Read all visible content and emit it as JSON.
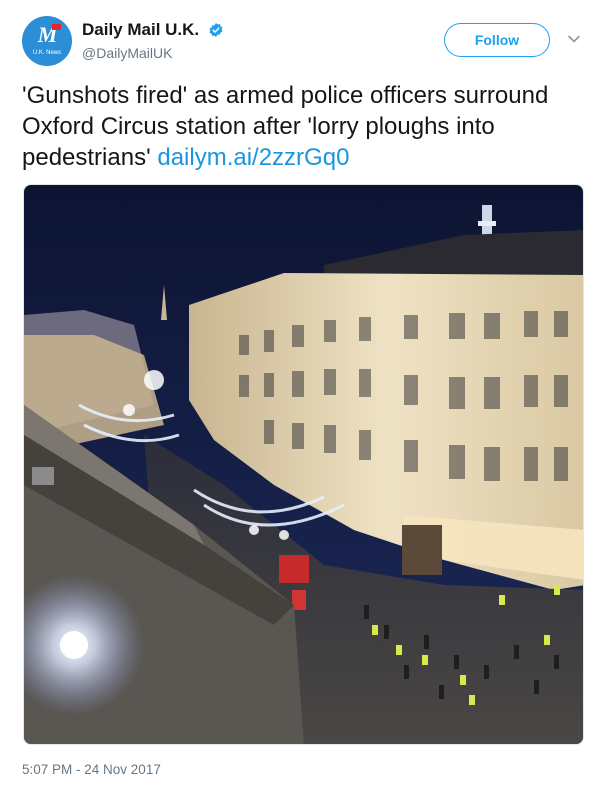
{
  "account": {
    "display_name": "Daily Mail U.K.",
    "handle": "@DailyMailUK",
    "avatar_logo_text": "M",
    "avatar_sub_text": "U.K. News",
    "verified": true
  },
  "follow_button": {
    "label": "Follow"
  },
  "tweet": {
    "text": "'Gunshots fired' as armed police officers surround Oxford Circus station after 'lorry ploughs into pedestrians'",
    "link": "dailym.ai/2zzrGq0"
  },
  "photo": {
    "description_colors": {
      "sky": "#141b3a",
      "building": "#e8d9b8",
      "street": "#3a3836",
      "lights": "#d7e6ff"
    }
  },
  "timestamp": "5:07 PM - 24 Nov 2017",
  "colors": {
    "accent": "#1da1f2",
    "link": "#1b95e0",
    "muted": "#657786"
  },
  "icons": {
    "verified": "verified-badge-icon",
    "caret": "chevron-down-icon"
  }
}
